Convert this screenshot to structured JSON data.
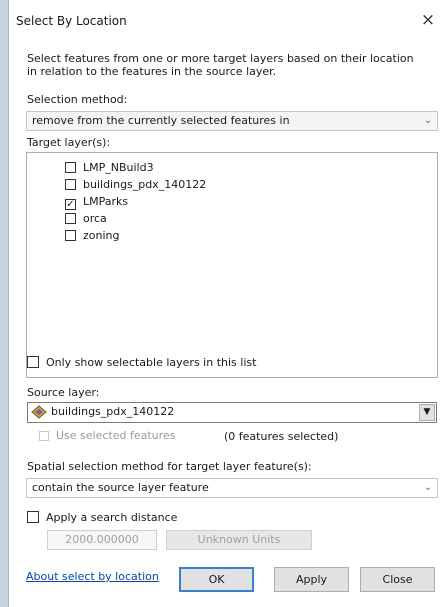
{
  "window": {
    "title": "Select By Location",
    "close_glyph": "×"
  },
  "description": "Select features from one or more target layers based on their location in relation to the features in the source layer.",
  "selection_method": {
    "label": "Selection method:",
    "value": "remove from the currently selected features in"
  },
  "target_layers": {
    "label": "Target layer(s):",
    "items": [
      {
        "label": "LMP_NBuild3",
        "checked": false
      },
      {
        "label": "buildings_pdx_140122",
        "checked": false
      },
      {
        "label": "LMParks",
        "checked": true
      },
      {
        "label": "orca",
        "checked": false
      },
      {
        "label": "zoning",
        "checked": false
      }
    ]
  },
  "only_selectable": {
    "label": "Only show selectable layers in this list",
    "checked": false
  },
  "source_layer": {
    "label": "Source layer:",
    "value": "buildings_pdx_140122",
    "icon": "layer-diamond-icon",
    "use_selected_label": "Use selected features",
    "features_selected": "(0 features selected)"
  },
  "spatial_method": {
    "label": "Spatial selection method for target layer feature(s):",
    "value": "contain the source layer feature"
  },
  "search_distance": {
    "label": "Apply a search distance",
    "checked": false,
    "value": "2000.000000",
    "units": "Unknown Units"
  },
  "footer": {
    "about_link": "About select by location",
    "ok": "OK",
    "apply": "Apply",
    "close": "Close"
  }
}
